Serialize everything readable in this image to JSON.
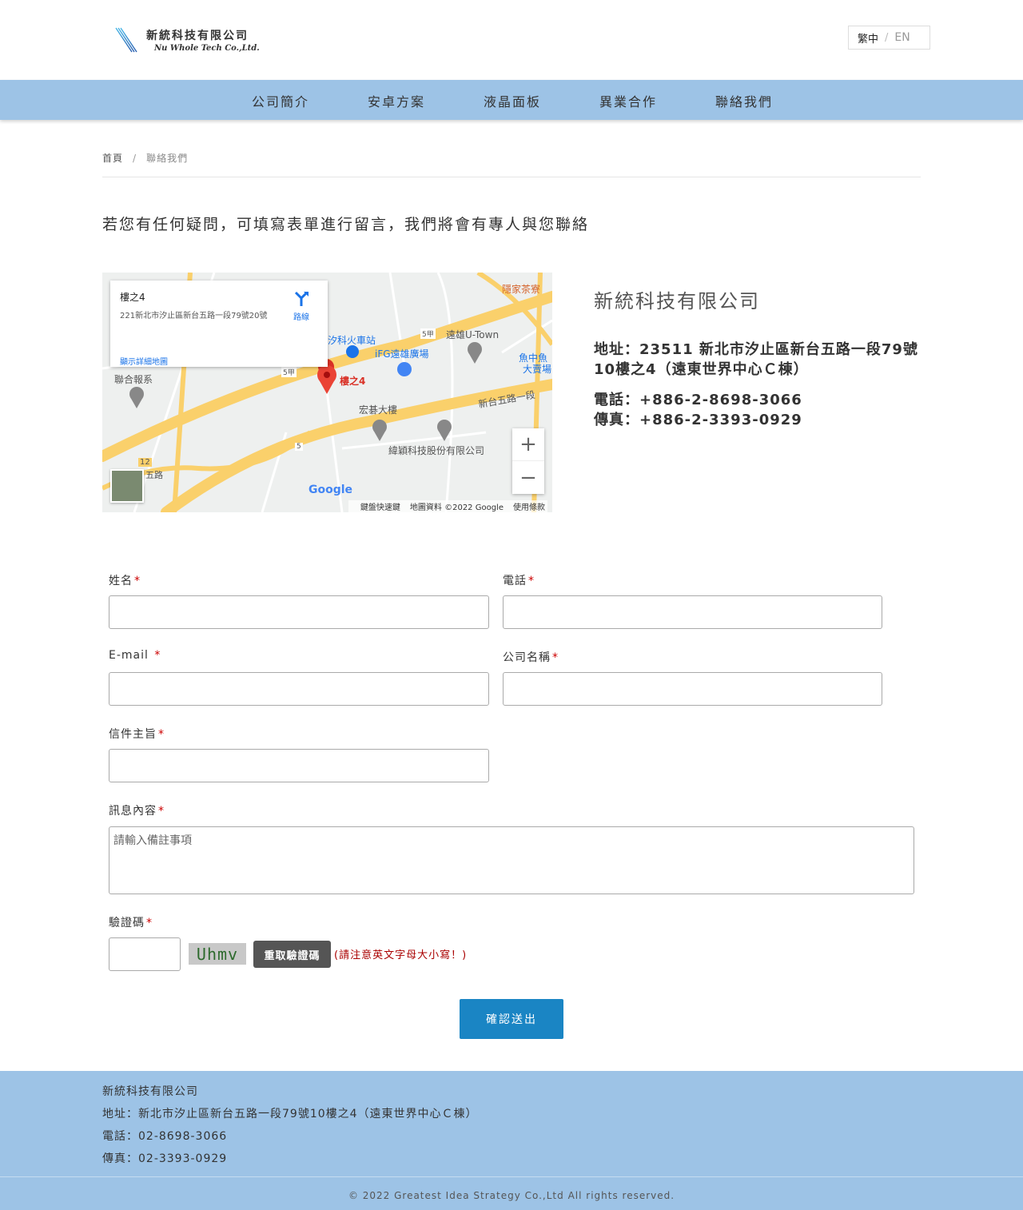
{
  "header": {
    "logo_zh": "新統科技有限公司",
    "logo_en": "Nu Whole Tech Co.,Ltd.",
    "lang_zh": "繁中",
    "lang_sep": "/",
    "lang_en": "EN"
  },
  "nav": {
    "items": [
      "公司簡介",
      "安卓方案",
      "液晶面板",
      "異業合作",
      "聯絡我們"
    ]
  },
  "breadcrumb": {
    "home": "首頁",
    "sep": "/",
    "current": "聯絡我們"
  },
  "intro": "若您有任何疑問，可填寫表單進行留言，我們將會有專人與您聯絡",
  "map": {
    "info_title": "樓之4",
    "info_address": "221新北市汐止區新台五路一段79號20號",
    "info_link": "顯示詳細地圖",
    "route_label": "路線",
    "marker_label": "樓之4",
    "places": [
      "隱家茶寮",
      "汐科火車站",
      "遠雄U-Town",
      "iFG遠雄廣場",
      "聯合報系",
      "宏碁大樓",
      "緯穎科技股份有限公司",
      "新台五路一段",
      "魚中魚",
      "大賣場",
      "五路"
    ],
    "road_numbers": [
      "5甲",
      "5甲",
      "5",
      "12"
    ],
    "zoom_in": "+",
    "zoom_out": "−",
    "google": "Google",
    "footer_shortcuts": "鍵盤快速鍵",
    "footer_data": "地圖資料 ©2022 Google",
    "footer_terms": "使用條款"
  },
  "company": {
    "name": "新統科技有限公司",
    "address": "地址：23511 新北市汐止區新台五路一段79號10樓之4（遠東世界中心Ｃ棟）",
    "tel": "電話：+886-2-8698-3066",
    "fax": "傳真：+886-2-3393-0929"
  },
  "form": {
    "name_label": "姓名",
    "phone_label": "電話",
    "email_label": "E-mail ",
    "company_label": "公司名稱",
    "subject_label": "信件主旨",
    "message_label": "訊息內容",
    "message_placeholder": "請輸入備註事項",
    "captcha_label": "驗證碼",
    "required_mark": "*",
    "captcha_text": "Uhmv",
    "refresh_button": "重取驗證碼",
    "captcha_note": "(請注意英文字母大小寫！)",
    "submit_button": "確認送出"
  },
  "footer": {
    "company": "新統科技有限公司",
    "address": "地址：新北市汐止區新台五路一段79號10樓之4（遠東世界中心Ｃ棟）",
    "tel": "電話：02-8698-3066",
    "fax": "傳真：02-3393-0929",
    "copyright": "© 2022 Greatest Idea Strategy Co.,Ltd All rights reserved."
  },
  "colors": {
    "nav_bg": "#9dc3e6",
    "submit_bg": "#1a85c4",
    "required": "#cc0000"
  }
}
